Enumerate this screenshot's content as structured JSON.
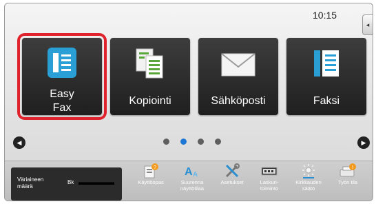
{
  "status": {
    "time": "10:15"
  },
  "side_tab": {
    "icon": "collapse-left-icon"
  },
  "tiles": [
    {
      "label": "Easy\nFax",
      "line1": "Easy",
      "line2": "Fax",
      "icon": "easy-fax-icon",
      "selected": true
    },
    {
      "label": "Kopiointi",
      "icon": "copy-icon"
    },
    {
      "label": "Sähköposti",
      "icon": "email-icon"
    },
    {
      "label": "Faksi",
      "icon": "fax-icon"
    }
  ],
  "pager": {
    "pages": 4,
    "current": 2,
    "prev_icon": "chevron-left-icon",
    "next_icon": "chevron-right-icon"
  },
  "toner": {
    "label_line1": "Väriaineen",
    "label_line2": "määrä",
    "color_label": "Bk",
    "level": 1.0
  },
  "toolbar": [
    {
      "line1": "Käyttöopas",
      "line2": "",
      "icon": "manual-icon"
    },
    {
      "line1": "Suurenna",
      "line2": "näyttötilaa",
      "icon": "zoom-text-icon"
    },
    {
      "line1": "Asetukset",
      "line2": "",
      "icon": "settings-icon"
    },
    {
      "line1": "Laskuri-",
      "line2": "toiminto",
      "icon": "counter-icon"
    },
    {
      "line1": "Kirkkauden",
      "line2": "säätö",
      "icon": "brightness-icon"
    },
    {
      "line1": "Työn tila",
      "line2": "",
      "icon": "job-status-icon"
    }
  ],
  "colors": {
    "accent": "#1e77d3",
    "selected_outline": "#e0222c",
    "tile_bg": "#2b2b2b"
  }
}
